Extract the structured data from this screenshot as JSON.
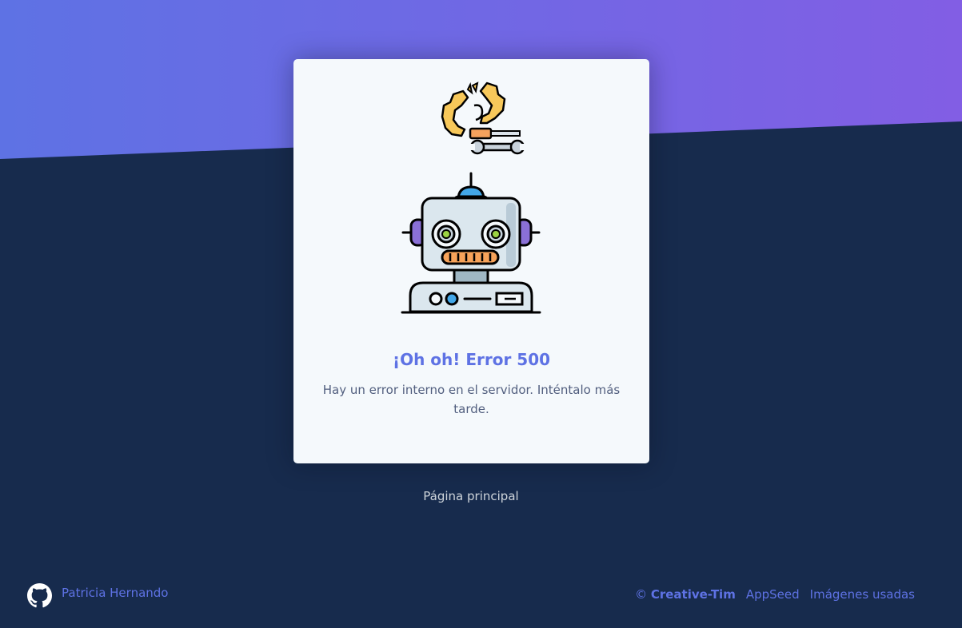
{
  "error": {
    "title": "¡Oh oh! Error 500",
    "message": "Hay un error interno en el servidor. Inténtalo más tarde."
  },
  "nav": {
    "home_link": "Página principal"
  },
  "footer": {
    "author": "Patricia Hernando",
    "github_icon": "github-icon",
    "copyright_symbol": "©",
    "copyright_brand": "Creative-Tim",
    "links": [
      "AppSeed",
      "Imágenes usadas"
    ]
  },
  "colors": {
    "accent": "#5e72e4",
    "gradient_start": "#5e72e4",
    "gradient_end": "#825ee4",
    "background": "#172b4d",
    "card": "#f5f9fc"
  },
  "icons": [
    "broken-gear-icon",
    "screwdriver-icon",
    "wrench-icon",
    "robot-icon"
  ]
}
